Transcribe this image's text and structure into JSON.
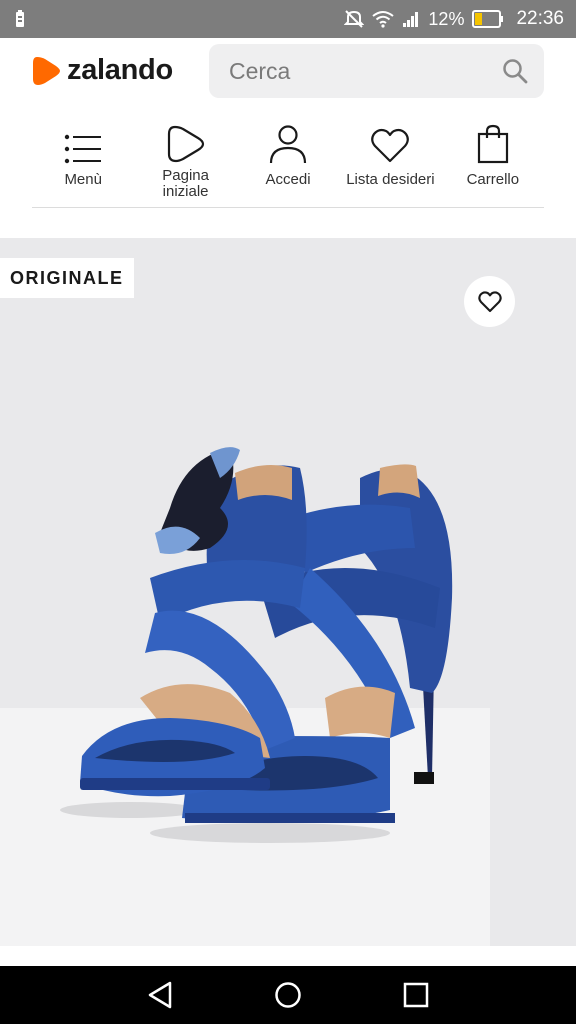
{
  "status_bar": {
    "battery_percent": "12%",
    "time": "22:36",
    "icons": [
      "battery-saver-icon",
      "mute-icon",
      "wifi-icon",
      "signal-icon",
      "battery-icon"
    ]
  },
  "header": {
    "logo_text": "zalando",
    "search": {
      "placeholder": "Cerca",
      "value": ""
    }
  },
  "nav": [
    {
      "label": "Menù",
      "icon": "menu-icon"
    },
    {
      "label": "Pagina\niniziale",
      "icon": "home-play-icon"
    },
    {
      "label": "Accedi",
      "icon": "user-icon"
    },
    {
      "label": "Lista desideri",
      "icon": "heart-icon"
    },
    {
      "label": "Carrello",
      "icon": "bag-icon"
    }
  ],
  "product": {
    "badge": "ORIGINALE",
    "wishlist_icon": "heart-icon",
    "image": "blue satin strappy high-heel sandals with flower detail"
  },
  "system_nav": [
    "back-icon",
    "home-circle-icon",
    "recents-icon"
  ]
}
